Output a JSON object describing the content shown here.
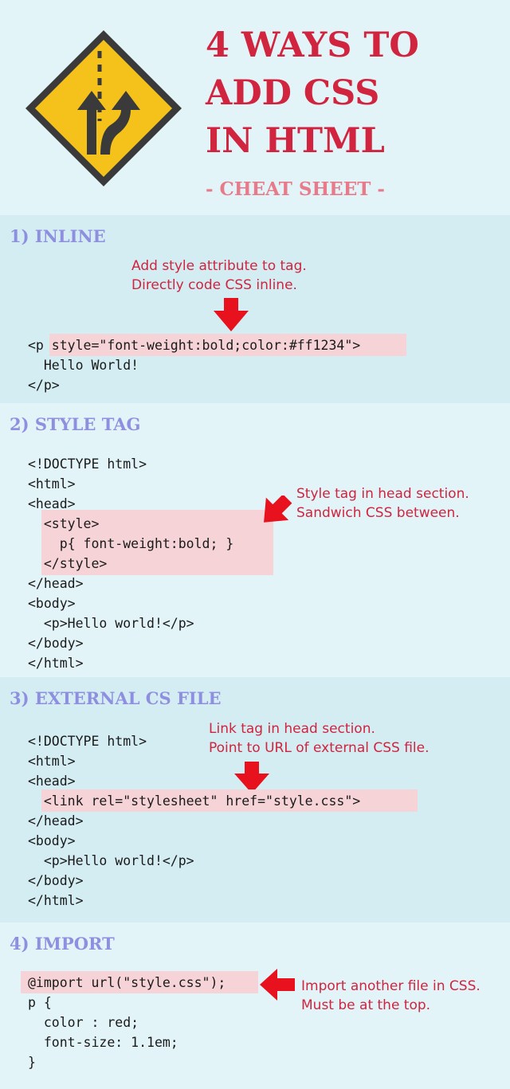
{
  "header": {
    "title_lines": [
      "4 WAYS TO",
      "ADD CSS",
      "IN HTML"
    ],
    "subtitle": "- CHEAT SHEET -"
  },
  "colors": {
    "accent": "#d0243f",
    "section_title": "#8f8fe0",
    "highlight": "#f6d3d6",
    "sign_yellow": "#f4c21a"
  },
  "sections": [
    {
      "title": "1) INLINE",
      "note_lines": [
        "Add style attribute to tag.",
        "Directly code CSS inline."
      ],
      "code_lines": [
        "<p style=\"font-weight:bold;color:#ff1234\">",
        "  Hello World!",
        "</p>"
      ]
    },
    {
      "title": "2) STYLE TAG",
      "note_lines": [
        "Style tag in head section.",
        "Sandwich CSS between."
      ],
      "code_lines": [
        "<!DOCTYPE html>",
        "<html>",
        "<head>",
        "  <style>",
        "    p{ font-weight:bold; }",
        "  </style>",
        "</head>",
        "<body>",
        "  <p>Hello world!</p>",
        "</body>",
        "</html>"
      ]
    },
    {
      "title": "3) EXTERNAL CS FILE",
      "note_lines": [
        "Link tag in head section.",
        "Point to URL of external CSS file."
      ],
      "code_lines": [
        "<!DOCTYPE html>",
        "<html>",
        "<head>",
        "  <link rel=\"stylesheet\" href=\"style.css\">",
        "</head>",
        "<body>",
        "  <p>Hello world!</p>",
        "</body>",
        "</html>"
      ]
    },
    {
      "title": "4) IMPORT",
      "note_lines": [
        "Import another file in CSS.",
        "Must be at the top."
      ],
      "code_lines": [
        "@import url(\"style.css\");",
        "p {",
        "  color : red;",
        "  font-size: 1.1em;",
        "}"
      ]
    }
  ]
}
